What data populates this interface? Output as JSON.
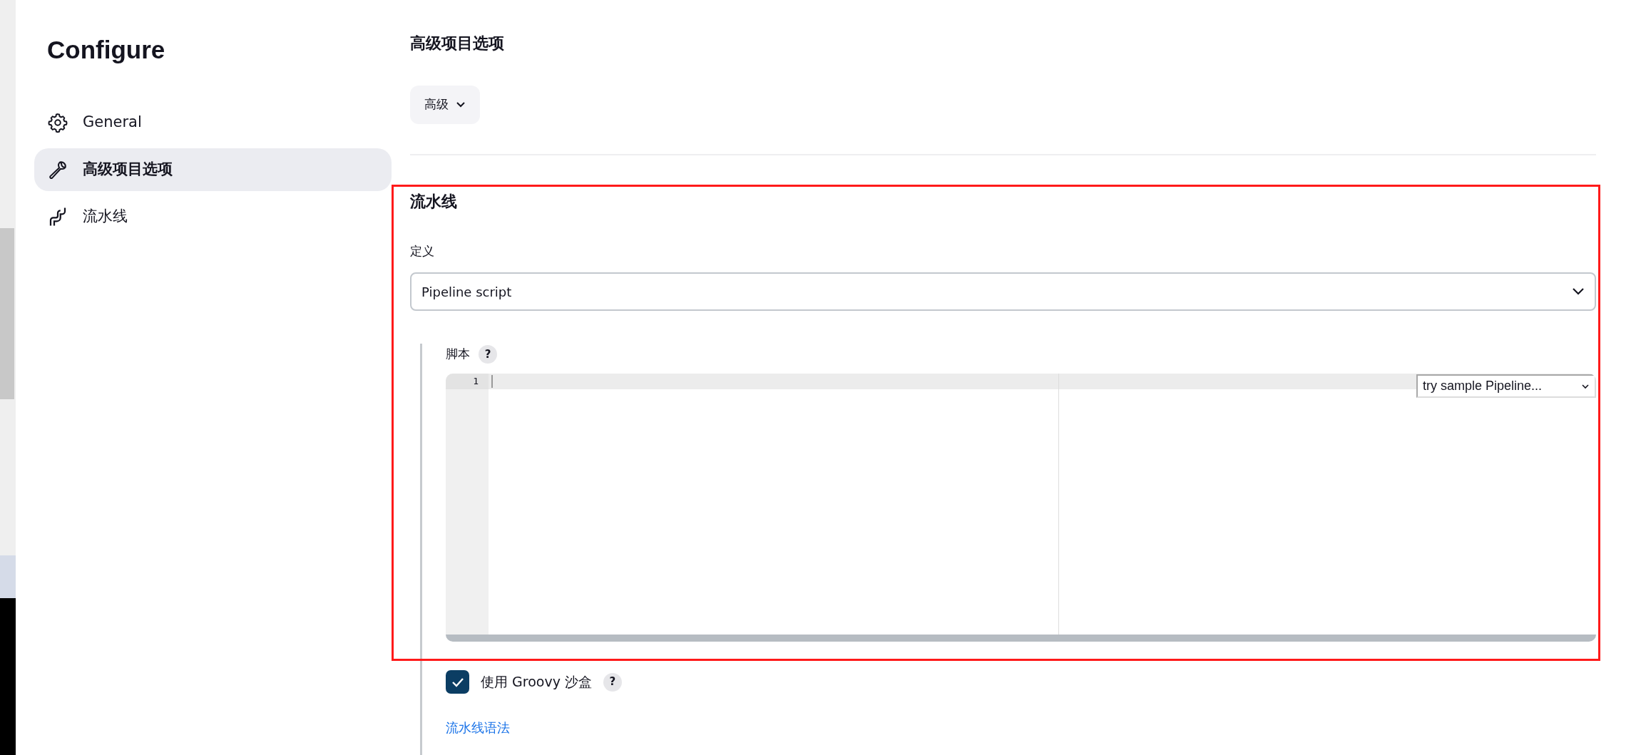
{
  "sidebar": {
    "title": "Configure",
    "items": [
      {
        "label": "General",
        "selected": false
      },
      {
        "label": "高级项目选项",
        "selected": true
      },
      {
        "label": "流水线",
        "selected": false
      }
    ]
  },
  "advanced_section": {
    "title": "高级项目选项",
    "button": "高级"
  },
  "pipeline_section": {
    "title": "流水线",
    "definition_label": "定义",
    "definition_value": "Pipeline script",
    "script_label": "脚本",
    "help": "?",
    "editor": {
      "line_numbers": [
        "1"
      ],
      "sample_dropdown": "try sample Pipeline..."
    },
    "sandbox": {
      "label": "使用 Groovy 沙盒",
      "checked": true,
      "help": "?"
    },
    "syntax_link": "流水线语法"
  }
}
